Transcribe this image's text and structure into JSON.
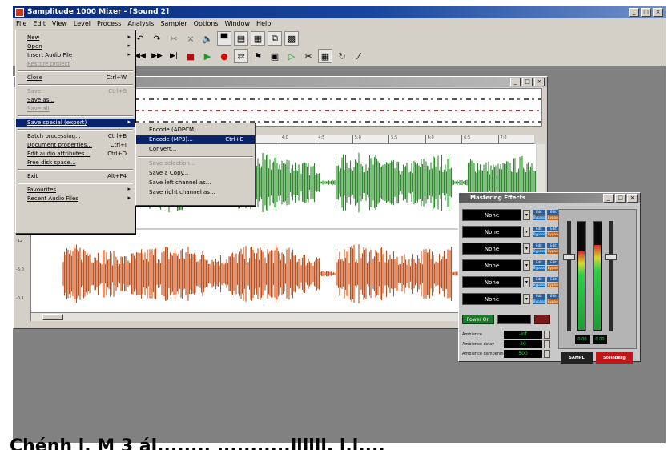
{
  "window": {
    "title": "Samplitude 1000 Mixer - [Sound 2]",
    "controls": [
      "_",
      "□",
      "×"
    ]
  },
  "menubar": [
    "File",
    "Edit",
    "View",
    "Level",
    "Process",
    "Analysis",
    "Sampler",
    "Options",
    "Window",
    "Help"
  ],
  "toolbar": {
    "row1_icons": [
      "undo-icon",
      "redo-icon",
      "cut-icon",
      "copy-icon",
      "paste-icon",
      "speaker-icon",
      "split-view-icon",
      "multi-window-icon",
      "grid-icon",
      "chain-icon",
      "image-icon"
    ],
    "row2_icons": [
      "rewind-icon",
      "fast-forward-icon",
      "skip-end-icon",
      "stop-icon",
      "play-icon",
      "record-icon",
      "loop-icon",
      "marker-icon",
      "camera-icon",
      "play-selection-icon",
      "scissors-icon",
      "grid-icon",
      "refresh-icon",
      "wand-icon"
    ]
  },
  "file_menu": {
    "items": [
      {
        "label": "New",
        "shortcut": "",
        "arrow": true
      },
      {
        "label": "Open",
        "shortcut": "",
        "arrow": true
      },
      {
        "label": "Insert Audio File",
        "shortcut": "",
        "arrow": true
      },
      {
        "label": "Restore project",
        "shortcut": "",
        "arrow": false,
        "dim": true
      },
      {
        "sep": true
      },
      {
        "label": "Close",
        "shortcut": "Ctrl+W",
        "arrow": false
      },
      {
        "sep": true
      },
      {
        "label": "Save",
        "shortcut": "Ctrl+S",
        "arrow": false,
        "dim": true
      },
      {
        "label": "Save as...",
        "shortcut": "",
        "arrow": false
      },
      {
        "label": "Save all",
        "shortcut": "",
        "arrow": false,
        "dim": true
      },
      {
        "sep": true
      },
      {
        "label": "Save special (export)",
        "shortcut": "",
        "arrow": true,
        "highlight": true
      },
      {
        "sep": true
      },
      {
        "label": "Batch processing...",
        "shortcut": "Ctrl+B",
        "arrow": false
      },
      {
        "label": "Document properties...",
        "shortcut": "Ctrl+I",
        "arrow": false
      },
      {
        "label": "Edit audio attributes...",
        "shortcut": "Ctrl+D",
        "arrow": false
      },
      {
        "label": "Free disk space...",
        "shortcut": "",
        "arrow": false
      },
      {
        "sep": true
      },
      {
        "label": "Exit",
        "shortcut": "Alt+F4",
        "arrow": false
      },
      {
        "sep": true
      },
      {
        "label": "Favourites",
        "shortcut": "",
        "arrow": true
      },
      {
        "label": "Recent Audio Files",
        "shortcut": "",
        "arrow": true
      }
    ]
  },
  "submenu": {
    "items": [
      {
        "label": "Encode (ADPCM)",
        "shortcut": ""
      },
      {
        "label": "Encode (MP3)...",
        "shortcut": "Ctrl+E",
        "highlight": true
      },
      {
        "label": "Convert...",
        "shortcut": ""
      },
      {
        "sep": true
      },
      {
        "label": "Save selection...",
        "shortcut": "",
        "dim": true
      },
      {
        "label": "Save a Copy...",
        "shortcut": ""
      },
      {
        "label": "Save left channel as...",
        "shortcut": ""
      },
      {
        "label": "Save right channel as...",
        "shortcut": ""
      }
    ]
  },
  "document": {
    "ruler_labels": [
      "2:0",
      "2:5",
      "3:0",
      "3:5",
      "4:0",
      "4:5",
      "5:0",
      "5:5",
      "6:0",
      "6:5",
      "7:0"
    ],
    "db_labels": [
      "-0.1",
      "-6.0",
      "-9.5",
      "-12",
      "-6.0",
      "-0.1"
    ],
    "channels": [
      {
        "name": "left-channel",
        "color": "#2e8b2e"
      },
      {
        "name": "right-channel",
        "color": "#c0501c"
      }
    ]
  },
  "mixer": {
    "title": "Mastering Effects",
    "fx_slots": [
      "None",
      "None",
      "None",
      "None",
      "None",
      "None"
    ],
    "fx_button_labels": [
      "Edit",
      "Bypass"
    ],
    "power_label": "Power On",
    "params": [
      {
        "label": "Ambience",
        "value": "-inf"
      },
      {
        "label": "Ambience delay",
        "value": "20"
      },
      {
        "label": "Ambience dampening",
        "value": "500"
      }
    ],
    "meter_levels": {
      "left": 0.72,
      "right": 0.78
    },
    "fader_positions": {
      "left": 0.3,
      "right": 0.3
    },
    "digit_readouts": [
      "0.00",
      "0.00"
    ],
    "brand_labels": [
      "SAMPL",
      "Steinberg"
    ]
  },
  "caption": "Chénh l. M 3 ál........ ...........llllll. l.l...."
}
